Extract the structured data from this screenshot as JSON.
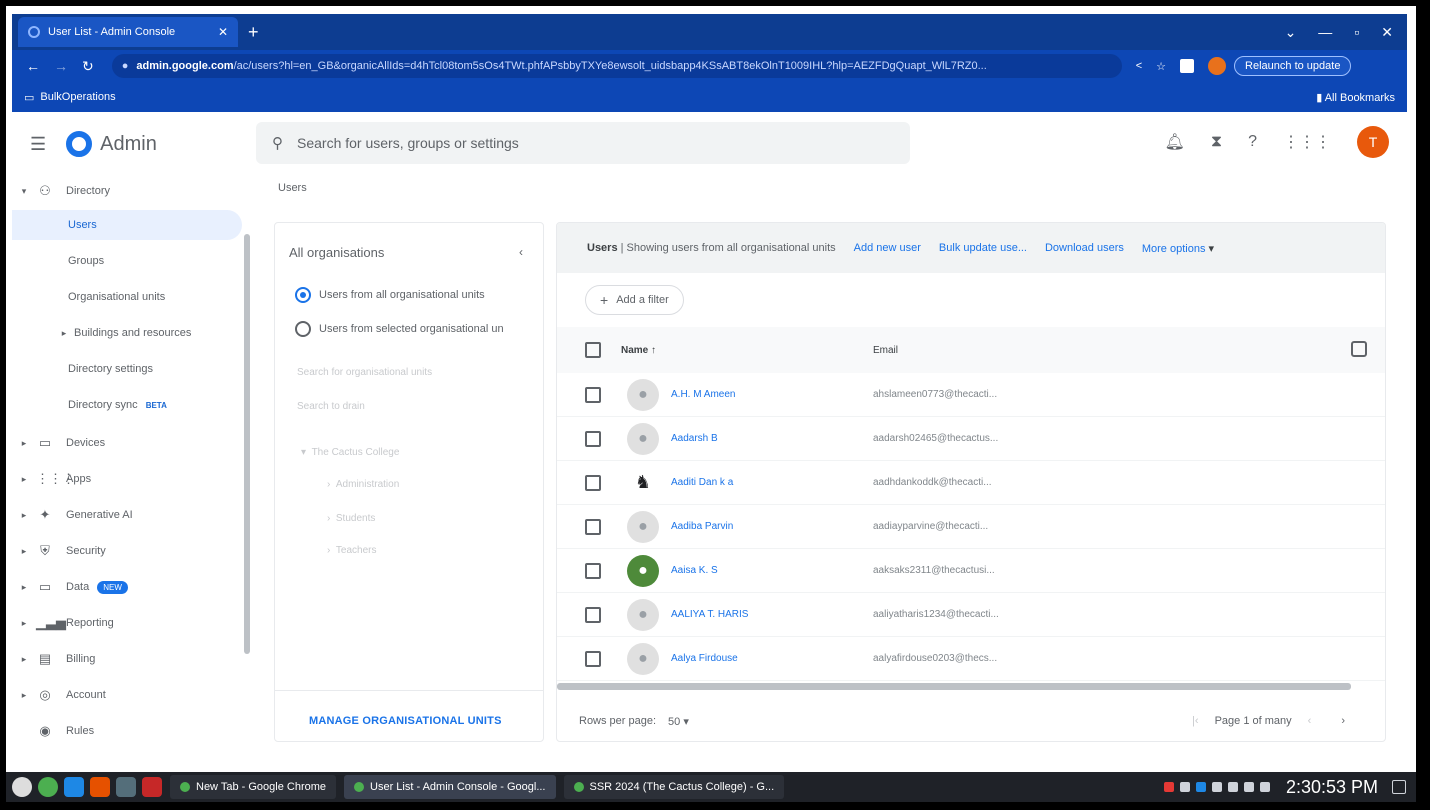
{
  "browser": {
    "tab_title": "User List - Admin Console",
    "tab_close": "✕",
    "new_tab": "+",
    "window_controls": [
      "⌄",
      "—",
      "▫",
      "✕"
    ],
    "url_host": "admin.google.com",
    "url_path": "/ac/users?hl=en_GB&organicAllIds=d4hTcl08tom5sOs4TWt.phfAPsbbyTXYe8ewsolt_uidsbapp4KSsABT8ekOlnT1009IHL?hlp=AEZFDgQuapt_WlL7RZ0...",
    "relaunch_label": "Relaunch to update",
    "bookmark_left": "BulkOperations",
    "bookmark_right": "All Bookmarks",
    "avatar_initial": "T"
  },
  "app": {
    "name": "Admin",
    "search_placeholder": "Search for users, groups or settings",
    "user_initial": "T",
    "breadcrumb": "Users"
  },
  "sidebar": {
    "items": [
      {
        "label": "Directory",
        "icon": "person-icon"
      },
      {
        "label": "Users"
      },
      {
        "label": "Groups"
      },
      {
        "label": "Organisational units"
      },
      {
        "label": "Buildings and resources"
      },
      {
        "label": "Directory settings"
      },
      {
        "label": "Directory sync",
        "badge": "BETA"
      },
      {
        "label": "Devices",
        "icon": "devices-icon"
      },
      {
        "label": "Apps",
        "icon": "apps-icon"
      },
      {
        "label": "Generative AI",
        "icon": "sparkle-icon"
      },
      {
        "label": "Security",
        "icon": "shield-icon"
      },
      {
        "label": "Data",
        "icon": "data-icon",
        "badge": "NEW"
      },
      {
        "label": "Reporting",
        "icon": "chart-icon"
      },
      {
        "label": "Billing",
        "icon": "billing-icon"
      },
      {
        "label": "Account",
        "icon": "account-icon"
      },
      {
        "label": "Rules",
        "icon": "rules-icon"
      }
    ]
  },
  "org_panel": {
    "title": "All organisations",
    "radio_all": "Users from all organisational units",
    "radio_selected": "Users from selected organisational un",
    "search_placeholder": "Search for organisational units",
    "search_placeholder2": "Search to drain",
    "tree_root": "The Cactus College",
    "tree_children": [
      "Administration",
      "Students",
      "Teachers"
    ],
    "manage_label": "MANAGE ORGANISATIONAL UNITS"
  },
  "users_panel": {
    "heading_bold": "Users",
    "heading_rest": " | Showing users from all organisational units",
    "actions": [
      "Add new user",
      "Bulk update use...",
      "Download users",
      "More options"
    ],
    "filter_label": "Add a filter",
    "col_name": "Name",
    "col_email": "Email",
    "rows": [
      {
        "name": "A.H. M Ameen",
        "email": "ahslameen0773@thecacti..."
      },
      {
        "name": "Aadarsh B",
        "email": "aadarsh02465@thecactus..."
      },
      {
        "name": "Aaditi Dan k a",
        "email": "aadhdankoddk@thecacti..."
      },
      {
        "name": "Aadiba Parvin",
        "email": "aadiayparvine@thecacti..."
      },
      {
        "name": "Aaisa K. S",
        "email": "aaksaks2311@thecactusi..."
      },
      {
        "name": "AALIYA T. HARIS",
        "email": "aaliyatharis1234@thecacti..."
      },
      {
        "name": "Aalya Firdouse",
        "email": "aalyafirdouse0203@thecs..."
      }
    ],
    "rows_per_page_label": "Rows per page:",
    "rows_per_page": "50",
    "page_label": "Page 1 of many"
  },
  "taskbar": {
    "windows": [
      "New Tab - Google Chrome",
      "User List - Admin Console - Googl...",
      "SSR 2024 (The Cactus College) - G..."
    ],
    "clock": "2:30:53 PM"
  }
}
